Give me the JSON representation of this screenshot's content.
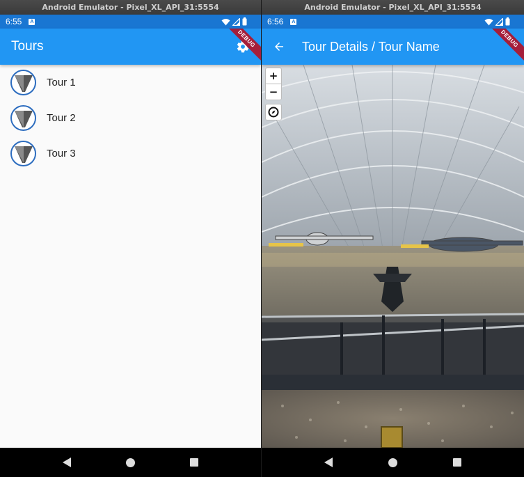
{
  "left": {
    "window_title": "Android Emulator - Pixel_XL_API_31:5554",
    "status_time": "6:55",
    "appbar_title": "Tours",
    "debug_label": "DEBUG",
    "tours": [
      {
        "label": "Tour 1"
      },
      {
        "label": "Tour 2"
      },
      {
        "label": "Tour 3"
      }
    ]
  },
  "right": {
    "window_title": "Android Emulator - Pixel_XL_API_31:5554",
    "status_time": "6:56",
    "appbar_title": "Tour Details / Tour Name",
    "debug_label": "DEBUG",
    "zoom_in": "+",
    "zoom_out": "−"
  },
  "colors": {
    "appbar": "#2196f3",
    "statusbar": "#1976d2",
    "debug_ribbon": "#a51e3a"
  },
  "icons": {
    "settings": "gear-icon",
    "back": "arrow-back-icon",
    "compass": "compass-icon",
    "nav_back": "triangle-back-icon",
    "nav_home": "circle-home-icon",
    "nav_recents": "square-recents-icon"
  }
}
